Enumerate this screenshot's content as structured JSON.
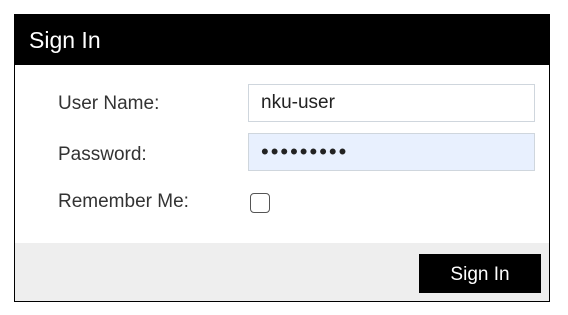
{
  "dialog": {
    "title": "Sign In"
  },
  "form": {
    "username_label": "User Name:",
    "username_value": "nku-user",
    "password_label": "Password:",
    "password_value": "•••••••••",
    "remember_label": "Remember Me:",
    "remember_checked": false
  },
  "footer": {
    "signin_label": "Sign In"
  }
}
